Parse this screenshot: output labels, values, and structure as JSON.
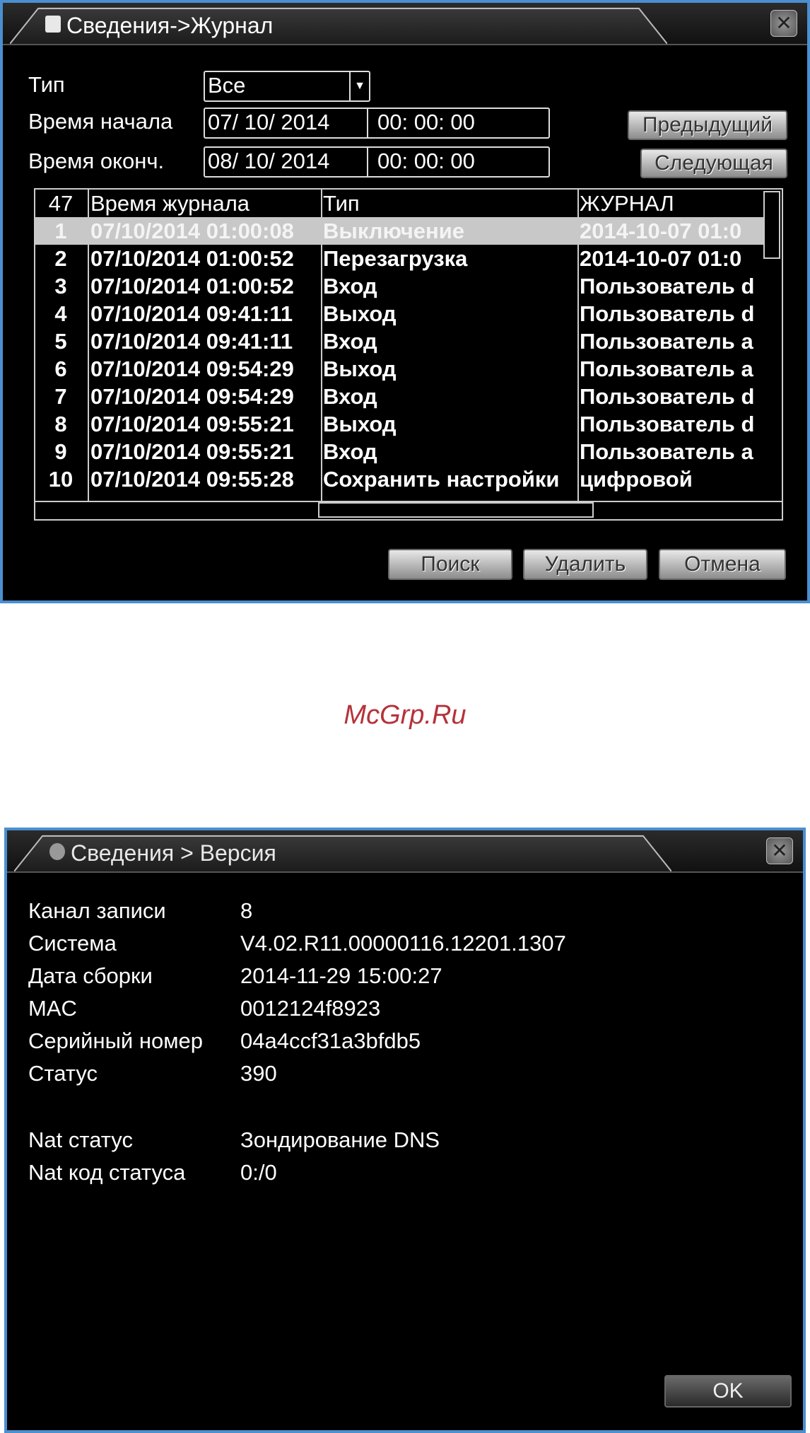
{
  "log_window": {
    "title": "Сведения->Журнал",
    "type_label": "Тип",
    "type_value": "Все",
    "start_label": "Время начала",
    "start_date": "07/ 10/ 2014",
    "start_time": "00: 00: 00",
    "end_label": "Время оконч.",
    "end_date": "08/ 10/ 2014",
    "end_time": "00: 00: 00",
    "prev_button": "Предыдущий",
    "next_button": "Следующая",
    "table": {
      "count": "47",
      "headers": [
        "Время журнала",
        "Тип",
        "ЖУРНАЛ"
      ],
      "rows": [
        {
          "num": "1",
          "time": "07/10/2014 01:00:08",
          "type": "Выключение",
          "log": "2014-10-07 01:0"
        },
        {
          "num": "2",
          "time": "07/10/2014 01:00:52",
          "type": "Перезагрузка",
          "log": "2014-10-07 01:0"
        },
        {
          "num": "3",
          "time": "07/10/2014 01:00:52",
          "type": "Вход",
          "log": "Пользователь d"
        },
        {
          "num": "4",
          "time": "07/10/2014 09:41:11",
          "type": "Выход",
          "log": "Пользователь d"
        },
        {
          "num": "5",
          "time": "07/10/2014 09:41:11",
          "type": "Вход",
          "log": "Пользователь a"
        },
        {
          "num": "6",
          "time": "07/10/2014 09:54:29",
          "type": "Выход",
          "log": "Пользователь a"
        },
        {
          "num": "7",
          "time": "07/10/2014 09:54:29",
          "type": "Вход",
          "log": "Пользователь d"
        },
        {
          "num": "8",
          "time": "07/10/2014 09:55:21",
          "type": "Выход",
          "log": "Пользователь d"
        },
        {
          "num": "9",
          "time": "07/10/2014 09:55:21",
          "type": "Вход",
          "log": "Пользователь a"
        },
        {
          "num": "10",
          "time": "07/10/2014 09:55:28",
          "type": "Сохранить настройки",
          "log": "цифровой"
        }
      ]
    },
    "search_button": "Поиск",
    "delete_button": "Удалить",
    "cancel_button": "Отмена"
  },
  "watermark": "McGrp.Ru",
  "version_window": {
    "title": "Сведения > Версия",
    "items": [
      {
        "label": "Канал записи",
        "value": "8"
      },
      {
        "label": "Система",
        "value": "V4.02.R11.00000116.12201.1307"
      },
      {
        "label": "Дата сборки",
        "value": "2014-11-29 15:00:27"
      },
      {
        "label": "MAC",
        "value": "0012124f8923"
      },
      {
        "label": "Серийный номер",
        "value": "04a4ccf31a3bfdb5"
      },
      {
        "label": "Статус",
        "value": "390"
      },
      {
        "label": "Nat статус",
        "value": "Зондирование DNS"
      },
      {
        "label": "Nat код статуса",
        "value": "0:/0"
      }
    ],
    "ok_button": "OK"
  }
}
